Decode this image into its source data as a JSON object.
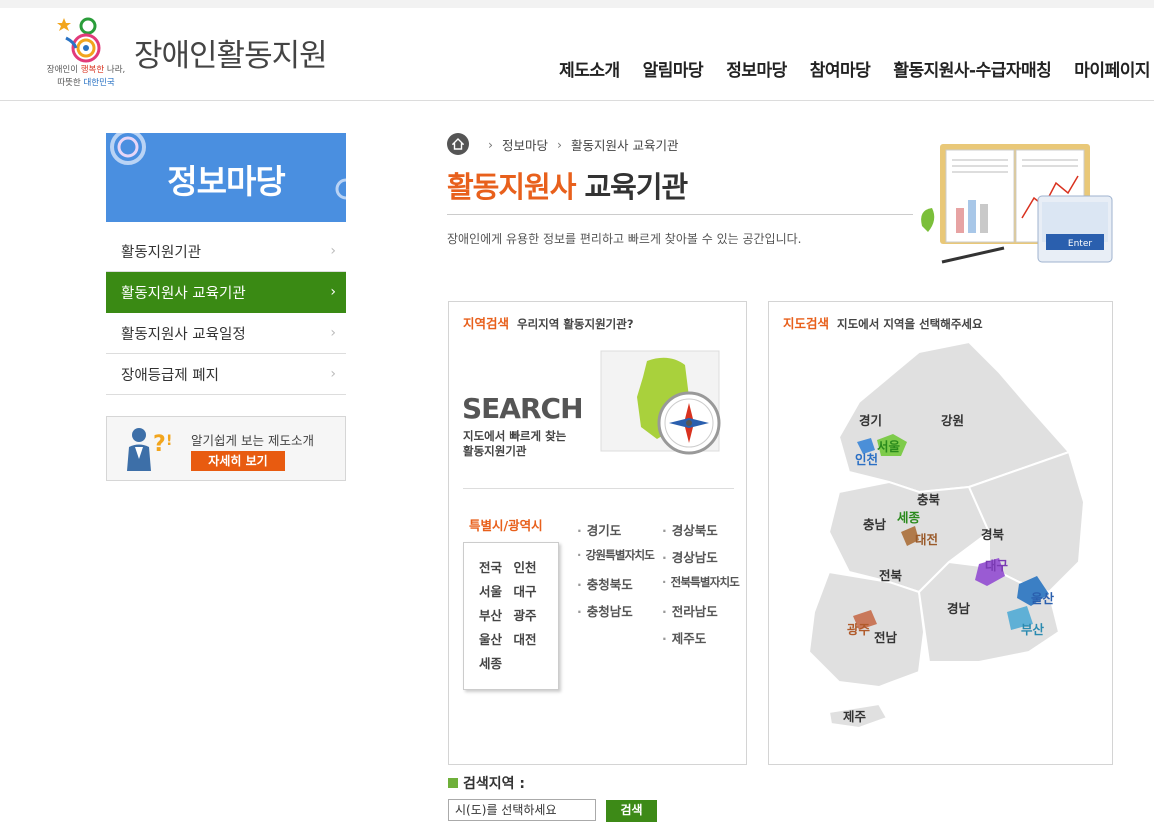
{
  "site": {
    "title": "장애인활동지원",
    "slogan_pre": "장애인이 ",
    "slogan_hl1": "행복한",
    "slogan_mid": " 나라,",
    "slogan_line2_pre": "따뜻한 ",
    "slogan_hl2": "대한민국"
  },
  "nav": [
    "제도소개",
    "알림마당",
    "정보마당",
    "참여마당",
    "활동지원사-수급자매칭",
    "마이페이지"
  ],
  "sidebar": {
    "title": "정보마당",
    "items": [
      {
        "label": "활동지원기관",
        "active": false
      },
      {
        "label": "활동지원사 교육기관",
        "active": true
      },
      {
        "label": "활동지원사 교육일정",
        "active": false
      },
      {
        "label": "장애등급제 폐지",
        "active": false
      }
    ],
    "chevron": "›",
    "banner": {
      "text": "알기쉽게 보는 제도소개",
      "button": "자세히 보기"
    }
  },
  "breadcrumb": [
    "정보마당",
    "활동지원사 교육기관"
  ],
  "page": {
    "title_accent": "활동지원사",
    "title_rest": " 교육기관",
    "description": "장애인에게 유용한 정보를 편리하고 빠르게 찾아볼 수 있는 공간입니다."
  },
  "illustration": {
    "enter_label": "Enter"
  },
  "region_search": {
    "label": "지역검색",
    "sub": "우리지역 활동지원기관?",
    "search_word": "SEARCH",
    "search_sub_1": "지도에서 빠르게 찾는",
    "search_sub_2": "활동지원기관",
    "metro_label": "특별시/광역시",
    "metro": [
      "전국",
      "인천",
      "서울",
      "대구",
      "부산",
      "광주",
      "울산",
      "대전",
      "세종"
    ],
    "provinces_col1": [
      "경기도",
      "강원특별자치도",
      "충청북도",
      "충청남도"
    ],
    "provinces_col2": [
      "경상북도",
      "경상남도",
      "전북특별자치도",
      "전라남도",
      "제주도"
    ]
  },
  "map_search": {
    "label": "지도검색",
    "sub": "지도에서 지역을 선택해주세요",
    "regions": {
      "gyeonggi": "경기",
      "gangwon": "강원",
      "seoul": "서울",
      "incheon": "인천",
      "chungbuk": "충북",
      "chungnam": "충남",
      "sejong": "세종",
      "daejeon": "대전",
      "gyeongbuk": "경북",
      "daegu": "대구",
      "jeonbuk": "전북",
      "gyeongnam": "경남",
      "ulsan": "울산",
      "busan": "부산",
      "gwangju": "광주",
      "jeonnam": "전남",
      "jeju": "제주"
    }
  },
  "search_region": {
    "label": "검색지역 :",
    "select_value": "시(도)를 선택하세요",
    "button": "검색"
  },
  "colors": {
    "accent_orange": "#e8601c",
    "active_green": "#3a8a14",
    "sidebar_blue": "#4a8fe0"
  }
}
